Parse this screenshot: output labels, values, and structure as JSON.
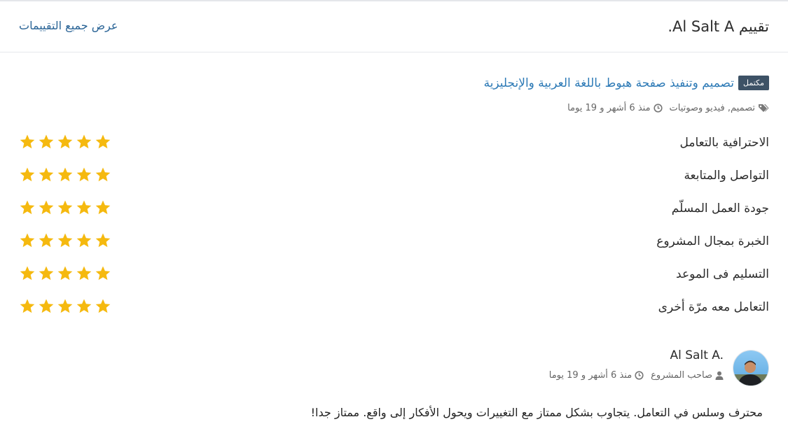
{
  "header": {
    "title": "تقييم Al Salt A.",
    "view_all_label": "عرض جميع التقييمات"
  },
  "project": {
    "status_badge": "مكتمل",
    "title": "تصميم وتنفيذ صفحة هبوط باللغة العربية والإنجليزية",
    "tags": "تصميم, فيديو وصوتيات",
    "time": "منذ 6 أشهر و 19 يوما"
  },
  "ratings": [
    {
      "label": "الاحترافية بالتعامل",
      "stars": 5
    },
    {
      "label": "التواصل والمتابعة",
      "stars": 5
    },
    {
      "label": "جودة العمل المسلّم",
      "stars": 5
    },
    {
      "label": "الخبرة بمجال المشروع",
      "stars": 5
    },
    {
      "label": "التسليم فى الموعد",
      "stars": 5
    },
    {
      "label": "التعامل معه مرّة أخرى",
      "stars": 5
    }
  ],
  "reviewer": {
    "name": "Al Salt A.",
    "role": "صاحب المشروع",
    "time": "منذ 6 أشهر و 19 يوما"
  },
  "review_text": "محترف وسلس في التعامل. يتجاوب بشكل ممتاز مع التغييرات ويحول الأفكار إلى واقع. ممتاز جدا!",
  "colors": {
    "star": "#f5b90f",
    "link": "#2d7ab6",
    "badge": "#3d5266"
  },
  "icons": {
    "tag": "tags-icon",
    "clock": "clock-icon",
    "user": "user-icon",
    "star": "star-icon"
  }
}
